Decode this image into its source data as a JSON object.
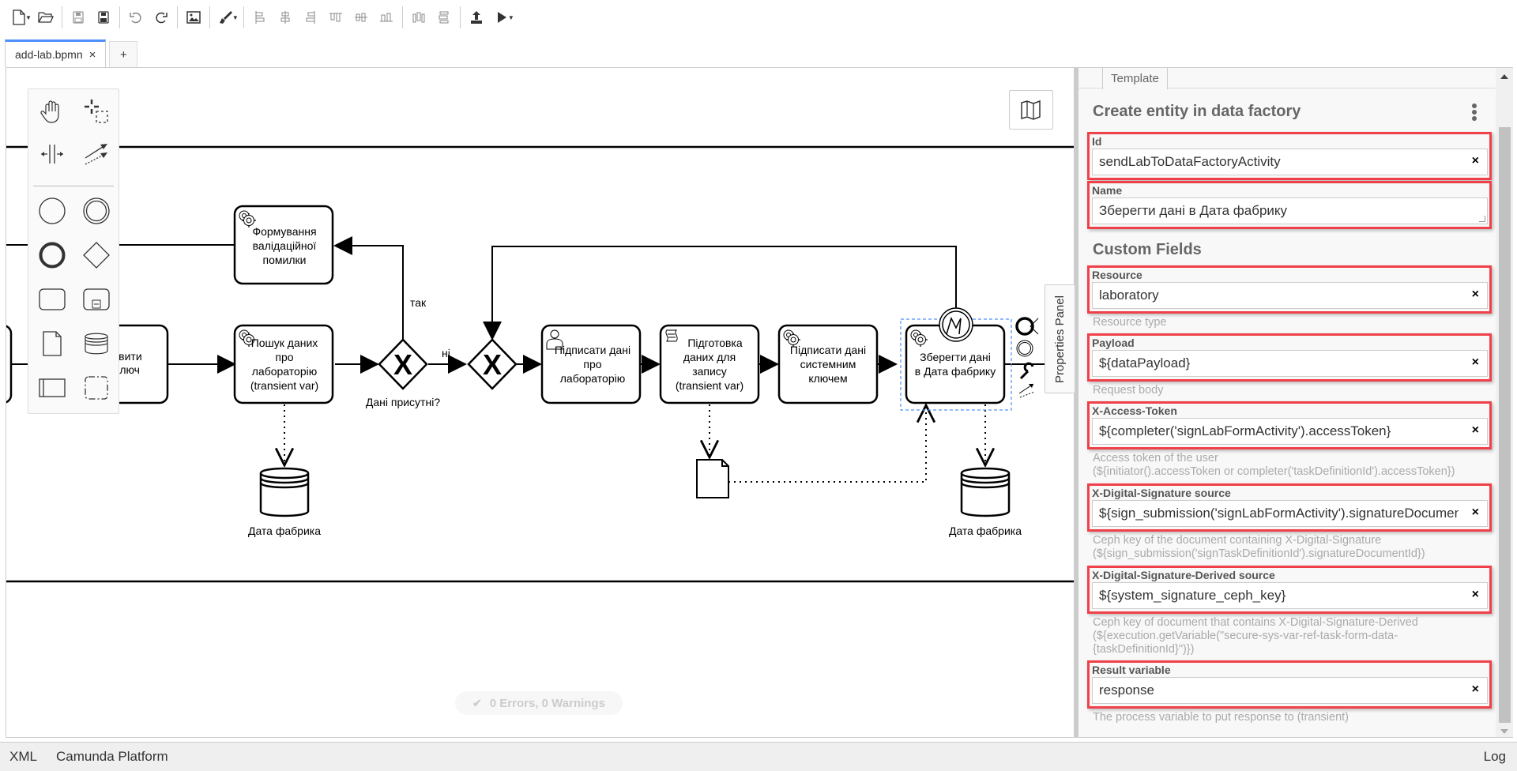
{
  "toolbar": {
    "buttons": [
      {
        "name": "new-file",
        "icon": "file-icon",
        "has_dropdown": true
      },
      {
        "name": "open-file",
        "icon": "folder-open-icon"
      },
      {
        "name": "save",
        "icon": "save-icon"
      },
      {
        "name": "save-as",
        "icon": "save-as-icon"
      },
      {
        "name": "undo",
        "icon": "undo-icon"
      },
      {
        "name": "redo",
        "icon": "redo-icon"
      },
      {
        "name": "export-image",
        "icon": "image-icon"
      },
      {
        "name": "color",
        "icon": "paint-brush-icon",
        "has_dropdown": true
      },
      {
        "name": "align-left",
        "icon": "align-left-icon"
      },
      {
        "name": "align-center",
        "icon": "align-center-icon"
      },
      {
        "name": "align-right",
        "icon": "align-right-icon"
      },
      {
        "name": "align-top",
        "icon": "align-top-icon"
      },
      {
        "name": "align-middle",
        "icon": "align-middle-icon"
      },
      {
        "name": "align-bottom",
        "icon": "align-bottom-icon"
      },
      {
        "name": "distribute-horizontal",
        "icon": "distribute-horizontal-icon"
      },
      {
        "name": "distribute-vertical",
        "icon": "distribute-vertical-icon"
      },
      {
        "name": "deploy",
        "icon": "deploy-icon"
      },
      {
        "name": "start-instance",
        "icon": "play-icon",
        "has_dropdown": true
      }
    ]
  },
  "tabs": {
    "active": {
      "label": "add-lab.bpmn",
      "close": "×"
    },
    "add_label": "+"
  },
  "diagram": {
    "tasks": {
      "t0": {
        "lines": [
          "овити",
          "ключ"
        ]
      },
      "t_error": {
        "type": "service",
        "lines": [
          "Формування",
          "валідаційної",
          "помилки"
        ]
      },
      "t_search": {
        "type": "service",
        "lines": [
          "Пошук даних",
          "про",
          "лабораторію",
          "(transient var)"
        ]
      },
      "t_sign": {
        "type": "user",
        "lines": [
          "Підписати дані",
          "про",
          "лабораторію"
        ]
      },
      "t_prep": {
        "type": "script",
        "lines": [
          "Підготовка",
          "даних для",
          "запису",
          "(transient var)"
        ]
      },
      "t_syssign": {
        "type": "service",
        "lines": [
          "Підписати дані",
          "системним",
          "ключем"
        ]
      },
      "t_save": {
        "type": "service",
        "lines": [
          "Зберегти дані",
          "в Дата фабрику"
        ],
        "selected": true
      }
    },
    "gateway_label": "Дані присутні?",
    "flow_yes": "так",
    "flow_no": "ні",
    "datastore_label_1": "Дата фабрика",
    "datastore_label_2": "Дата фабрика"
  },
  "palette": {
    "tools": [
      "hand-tool",
      "lasso-tool",
      "space-tool",
      "global-connect-tool"
    ],
    "elements": [
      "start-event",
      "intermediate-event",
      "end-event",
      "gateway",
      "task",
      "subprocess",
      "data-object",
      "data-store",
      "participant",
      "group"
    ]
  },
  "canvas": {
    "minimap_icon": "map-icon",
    "properties_toggle": "Properties Panel",
    "lint_status": "0 Errors, 0 Warnings"
  },
  "properties": {
    "tab": "Template",
    "title": "Create entity in data factory",
    "custom_fields_title": "Custom Fields",
    "fields": {
      "id": {
        "label": "Id",
        "value": "sendLabToDataFactoryActivity"
      },
      "name": {
        "label": "Name",
        "value": "Зберегти дані в Дата фабрику"
      },
      "resource": {
        "label": "Resource",
        "value": "laboratory",
        "description": "Resource type"
      },
      "payload": {
        "label": "Payload",
        "value": "${dataPayload}",
        "description": "Request body"
      },
      "access_token": {
        "label": "X-Access-Token",
        "value": "${completer('signLabFormActivity').accessToken}",
        "description_1": "Access token of the user",
        "description_2": "(${initiator().accessToken or completer('taskDefinitionId').accessToken})"
      },
      "signature": {
        "label": "X-Digital-Signature source",
        "value": "${sign_submission('signLabFormActivity').signatureDocumentId}",
        "description_1": "Ceph key of the document containing X-Digital-Signature",
        "description_2": "(${sign_submission('signTaskDefinitionId').signatureDocumentId})"
      },
      "signature_derived": {
        "label": "X-Digital-Signature-Derived source",
        "value": "${system_signature_ceph_key}",
        "description_1": "Ceph key of document that contains X-Digital-Signature-Derived",
        "description_2": "(${execution.getVariable(\"secure-sys-var-ref-task-form-data-",
        "description_3": "{taskDefinitionId}\")})"
      },
      "result": {
        "label": "Result variable",
        "value": "response",
        "description": "The process variable to put response to (transient)"
      }
    },
    "clear_glyph": "×",
    "highlight_color": "#f0414b"
  },
  "statusbar": {
    "xml": "XML",
    "platform": "Camunda Platform",
    "log": "Log"
  }
}
